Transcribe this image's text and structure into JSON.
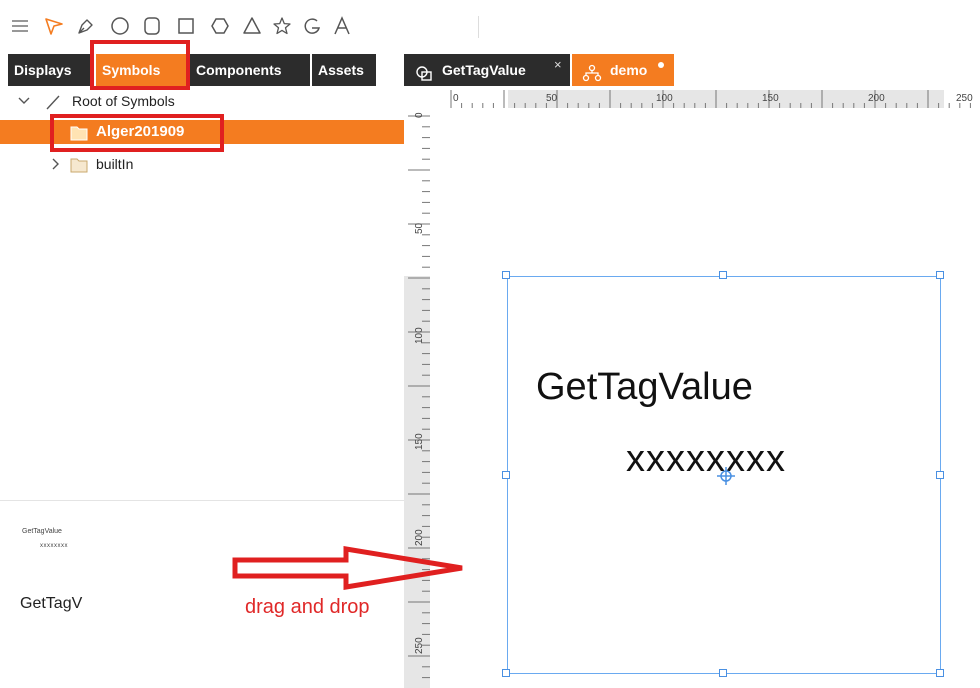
{
  "toolbar": {
    "tools": [
      {
        "name": "menu-icon",
        "tooltip": "Menu"
      },
      {
        "name": "select-arrow-icon",
        "tooltip": "Select"
      },
      {
        "name": "pen-icon",
        "tooltip": "Pen"
      },
      {
        "name": "circle-icon",
        "tooltip": "Circle"
      },
      {
        "name": "rounded-rect-icon",
        "tooltip": "Rounded rectangle"
      },
      {
        "name": "rectangle-icon",
        "tooltip": "Rectangle"
      },
      {
        "name": "hexagon-icon",
        "tooltip": "Polygon"
      },
      {
        "name": "triangle-icon",
        "tooltip": "Triangle"
      },
      {
        "name": "star-icon",
        "tooltip": "Star"
      },
      {
        "name": "arc-icon",
        "tooltip": "Arc"
      },
      {
        "name": "text-icon",
        "tooltip": "Text"
      }
    ],
    "accent_color": "#f47c20"
  },
  "left_panel": {
    "tabs": [
      {
        "label": "Displays",
        "active": false
      },
      {
        "label": "Symbols",
        "active": true
      },
      {
        "label": "Components",
        "active": false
      },
      {
        "label": "Assets",
        "active": false
      }
    ],
    "tree": {
      "root_label": "Root of Symbols",
      "items": [
        {
          "label": "Alger201909",
          "selected": true,
          "icon": "folder-icon"
        },
        {
          "label": "builtIn",
          "selected": false,
          "icon": "folder-icon"
        }
      ]
    },
    "preview": {
      "thumbnail_title": "GetTagValue",
      "thumbnail_sub": "xxxxxxxx",
      "symbol_label": "GetTagV"
    }
  },
  "editor": {
    "tabs": [
      {
        "label": "GetTagValue",
        "icon": "symbol-icon",
        "close": "×",
        "active": false
      },
      {
        "label": "demo",
        "icon": "network-icon",
        "modified": true,
        "active": true
      }
    ],
    "ruler_top_labels": [
      "0",
      "50",
      "100",
      "150",
      "200",
      "250"
    ],
    "ruler_left_labels": [
      "0",
      "50",
      "100",
      "150",
      "200",
      "250"
    ],
    "symbol": {
      "title": "GetTagValue",
      "value": "xxxxxxxx"
    }
  },
  "annotation": {
    "drag_text": "drag and drop",
    "color": "#e02020"
  },
  "colors": {
    "tab_dark": "#2c2c2c",
    "accent": "#f47c20",
    "selection": "#4a90e2"
  }
}
